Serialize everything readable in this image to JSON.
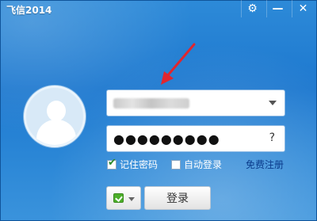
{
  "window": {
    "title": "飞信2014"
  },
  "titlebar": {
    "buttons": [
      {
        "icon": "gear-icon",
        "glyph": "⚙"
      },
      {
        "icon": "minimize-icon",
        "glyph": "—"
      },
      {
        "icon": "close-icon",
        "glyph": "✕"
      }
    ]
  },
  "login": {
    "password_mask": "●●●●●●●●●",
    "help_glyph": "?",
    "remember_password_label": "记住密码",
    "remember_password_checked": true,
    "auto_login_label": "自动登录",
    "auto_login_checked": false,
    "register_link": "免费注册",
    "login_button": "登录"
  },
  "colors": {
    "background": "#1d78cf",
    "pointer_arrow": "#e0262e",
    "link": "#0b3c8c"
  }
}
